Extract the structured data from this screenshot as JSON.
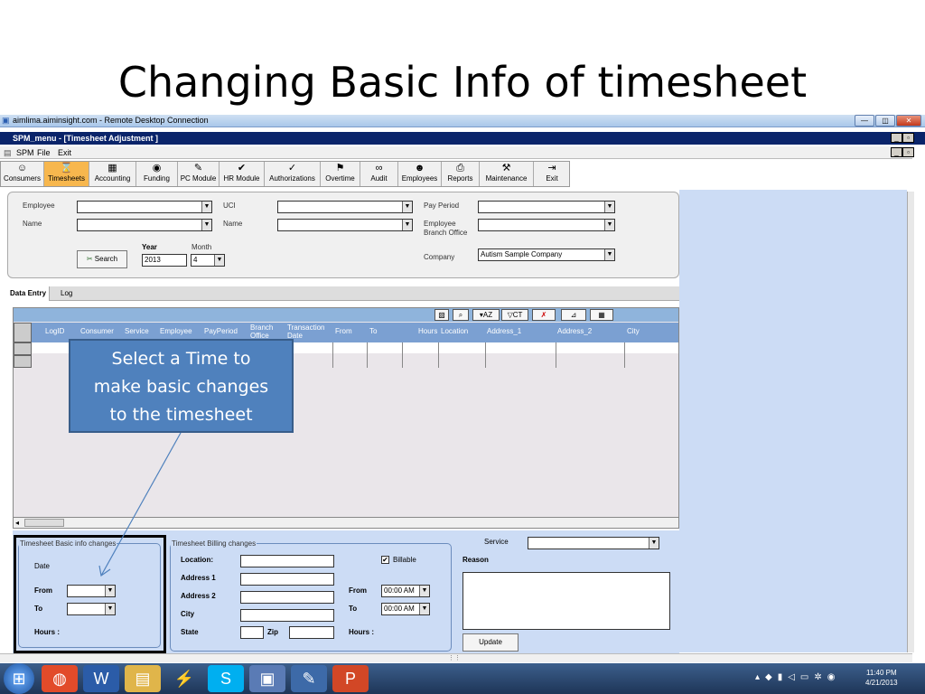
{
  "slide": {
    "title": "Changing Basic Info of timesheet"
  },
  "rdc": {
    "title": "aimlima.aiminsight.com - Remote Desktop Connection"
  },
  "app": {
    "title": "SPM_menu - [Timesheet Adjustment ]"
  },
  "menu": {
    "items": [
      "SPM",
      "File",
      "Exit"
    ]
  },
  "toolbar": {
    "buttons": [
      "Consumers",
      "Timesheets",
      "Accounting",
      "Funding",
      "PC Module",
      "HR Module",
      "Authorizations",
      "Overtime",
      "Audit",
      "Employees",
      "Reports",
      "Maintenance",
      "Exit"
    ],
    "active": "Timesheets"
  },
  "search": {
    "employee_label": "Employee",
    "name_label": "Name",
    "uci_label": "UCI",
    "name2_label": "Name",
    "pay_period_label": "Pay Period",
    "branch_label_1": "Employee",
    "branch_label_2": "Branch Office",
    "company_label": "Company",
    "company_value": "Autism Sample Company",
    "year_label": "Year",
    "month_label": "Month",
    "year_value": "2013",
    "month_value": "4",
    "search_button": "Search"
  },
  "tabs": [
    "Data Entry",
    "Log"
  ],
  "grid": {
    "tool_az": "AZ",
    "tool_ct": "CT",
    "columns": [
      "LogID",
      "Consumer",
      "Service",
      "Employee",
      "PayPeriod",
      "Branch Office",
      "Transaction Date",
      "From",
      "To",
      "Hours",
      "Location",
      "Address_1",
      "Address_2",
      "City"
    ]
  },
  "basic_info": {
    "legend": "Timesheet Basic info changes",
    "date_label": "Date",
    "from_label": "From",
    "to_label": "To",
    "hours_label": "Hours :"
  },
  "billing": {
    "legend": "Timesheet Billing changes",
    "location_label": "Location:",
    "address1_label": "Address 1",
    "address2_label": "Address 2",
    "city_label": "City",
    "state_label": "State",
    "zip_label": "Zip",
    "billable_label": "Billable",
    "from_label": "From",
    "to_label": "To",
    "hours_label": "Hours :",
    "from_time": "00:00 AM",
    "to_time": "00:00 AM"
  },
  "right": {
    "service_label": "Service",
    "reason_label": "Reason",
    "update_button": "Update"
  },
  "callout": {
    "line1": "Select a Time to",
    "line2": "make basic changes",
    "line3": "to the timesheet"
  },
  "clock": {
    "time": "11:40 PM",
    "date": "4/21/2013"
  }
}
